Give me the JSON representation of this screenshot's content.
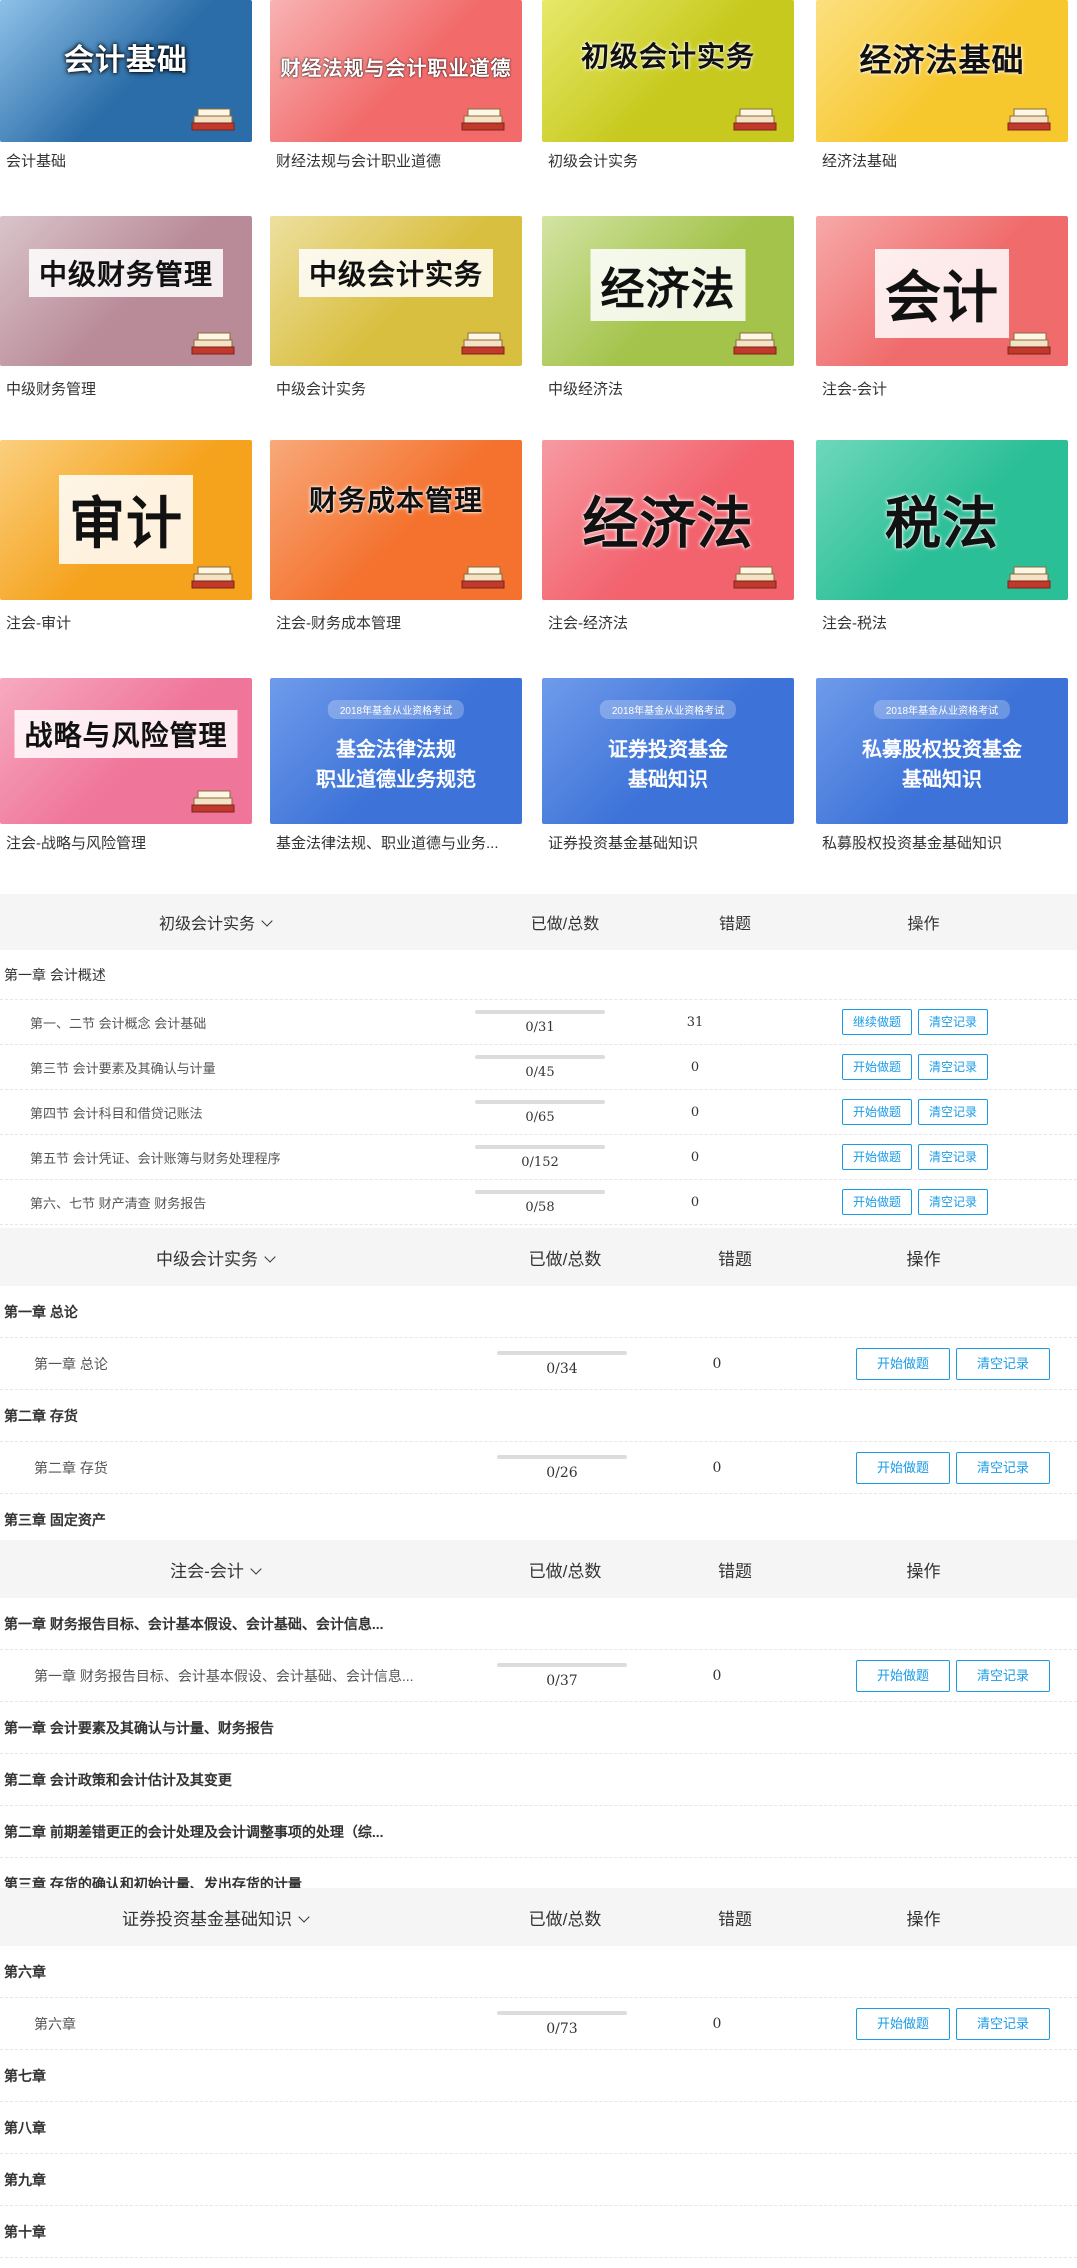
{
  "colors": {
    "accent": "#1a9be6",
    "header_bg": "#f5f5f5"
  },
  "courses": [
    {
      "title": "会计基础",
      "label": "会计基础",
      "bg": "#2b6da8",
      "bg2": "#8ec1e8",
      "style": "white-dark"
    },
    {
      "title": "财经法规与会计职业道德",
      "label": "财经法规与会计职业道德",
      "bg": "#f26a6a",
      "bg2": "#f8b3b3",
      "style": "white"
    },
    {
      "title": "初级会计实务",
      "label": "初级会计实务",
      "bg": "#c7c91e",
      "bg2": "#e7e96a",
      "style": "dark"
    },
    {
      "title": "经济法基础",
      "label": "经济法基础",
      "bg": "#f7c72e",
      "bg2": "#fbe07f",
      "style": "dark"
    },
    {
      "title": "中级财务管理",
      "label": "中级财务管理",
      "bg": "#b98a98",
      "bg2": "#d9c4ca",
      "style": "boxed"
    },
    {
      "title": "中级会计实务",
      "label": "中级会计实务",
      "bg": "#d9bf40",
      "bg2": "#ede0a0",
      "style": "boxed"
    },
    {
      "title": "经济法",
      "label": "中级经济法",
      "bg": "#a3c34b",
      "bg2": "#d3e4a3",
      "style": "boxed"
    },
    {
      "title": "会计",
      "label": "注会-会计",
      "bg": "#f06b6b",
      "bg2": "#f7a9a9",
      "style": "boxed-big"
    },
    {
      "title": "审计",
      "label": "注会-审计",
      "bg": "#f5a21c",
      "bg2": "#fbcf7e",
      "style": "boxed-big"
    },
    {
      "title": "财务成本管理",
      "label": "注会-财务成本管理",
      "bg": "#f4722e",
      "bg2": "#f8a97a",
      "style": "dark"
    },
    {
      "title": "经济法",
      "label": "注会-经济法",
      "bg": "#f2636e",
      "bg2": "#f79aa2",
      "style": "dark-big"
    },
    {
      "title": "税法",
      "label": "注会-税法",
      "bg": "#2bbf97",
      "bg2": "#6ed8bb",
      "style": "dark-big"
    },
    {
      "title": "战略与风险管理",
      "label": "注会-战略与风险管理",
      "bg": "#f0759a",
      "bg2": "#f6aac1",
      "style": "boxed"
    },
    {
      "title": "基金法律法规\n职业道德业务规范",
      "label": "基金法律法规、职业道德与业务...",
      "bg": "#3d73d8",
      "bg2": "#6f9bea",
      "style": "fund",
      "tag": "2018年基金从业资格考试"
    },
    {
      "title": "证券投资基金\n基础知识",
      "label": "证券投资基金基础知识",
      "bg": "#3d73d8",
      "bg2": "#6f9bea",
      "style": "fund",
      "tag": "2018年基金从业资格考试"
    },
    {
      "title": "私募股权投资基金\n基础知识",
      "label": "私募股权投资基金基础知识",
      "bg": "#3d73d8",
      "bg2": "#6f9bea",
      "style": "fund",
      "tag": "2018年基金从业资格考试"
    }
  ],
  "sections": [
    {
      "name": "初级会计实务",
      "col_done": "已做/总数",
      "col_wrong": "错题",
      "col_ops": "操作",
      "size": "small",
      "rows": [
        {
          "type": "chapter",
          "text": "第一章 会计概述"
        },
        {
          "type": "lesson",
          "text": "第一、二节 会计概念 会计基础",
          "done": 0,
          "total": 31,
          "count": "0/31",
          "wrong": "31",
          "btn1": "继续做题",
          "btn2": "清空记录"
        },
        {
          "type": "lesson",
          "text": "第三节 会计要素及其确认与计量",
          "done": 0,
          "total": 45,
          "count": "0/45",
          "wrong": "0",
          "btn1": "开始做题",
          "btn2": "清空记录"
        },
        {
          "type": "lesson",
          "text": "第四节 会计科目和借贷记账法",
          "done": 0,
          "total": 65,
          "count": "0/65",
          "wrong": "0",
          "btn1": "开始做题",
          "btn2": "清空记录"
        },
        {
          "type": "lesson",
          "text": "第五节 会计凭证、会计账簿与财务处理程序",
          "done": 0,
          "total": 152,
          "count": "0/152",
          "wrong": "0",
          "btn1": "开始做题",
          "btn2": "清空记录"
        },
        {
          "type": "lesson",
          "text": "第六、七节 财产清查 财务报告",
          "done": 0,
          "total": 58,
          "count": "0/58",
          "wrong": "0",
          "btn1": "开始做题",
          "btn2": "清空记录"
        }
      ]
    },
    {
      "name": "中级会计实务",
      "col_done": "已做/总数",
      "col_wrong": "错题",
      "col_ops": "操作",
      "size": "big",
      "rows": [
        {
          "type": "chapter",
          "text": "第一章 总论"
        },
        {
          "type": "lesson",
          "text": "第一章 总论",
          "done": 0,
          "total": 34,
          "count": "0/34",
          "wrong": "0",
          "btn1": "开始做题",
          "btn2": "清空记录"
        },
        {
          "type": "chapter",
          "text": "第二章 存货"
        },
        {
          "type": "lesson",
          "text": "第二章 存货",
          "done": 0,
          "total": 26,
          "count": "0/26",
          "wrong": "0",
          "btn1": "开始做题",
          "btn2": "清空记录"
        },
        {
          "type": "chapter",
          "text": "第三章 固定资产"
        }
      ]
    },
    {
      "name": "注会-会计",
      "col_done": "已做/总数",
      "col_wrong": "错题",
      "col_ops": "操作",
      "size": "big",
      "rows": [
        {
          "type": "chapter",
          "text": "第一章 财务报告目标、会计基本假设、会计基础、会计信息..."
        },
        {
          "type": "lesson",
          "text": "第一章 财务报告目标、会计基本假设、会计基础、会计信息...",
          "done": 0,
          "total": 37,
          "count": "0/37",
          "wrong": "0",
          "btn1": "开始做题",
          "btn2": "清空记录"
        },
        {
          "type": "chapter",
          "text": "第一章 会计要素及其确认与计量、财务报告"
        },
        {
          "type": "chapter",
          "text": "第二章 会计政策和会计估计及其变更"
        },
        {
          "type": "chapter",
          "text": "第二章 前期差错更正的会计处理及会计调整事项的处理（综..."
        },
        {
          "type": "chapter",
          "text": "第三章 存货的确认和初始计量、发出存货的计量"
        }
      ]
    },
    {
      "name": "证券投资基金基础知识",
      "col_done": "已做/总数",
      "col_wrong": "错题",
      "col_ops": "操作",
      "size": "big",
      "rows": [
        {
          "type": "chapter",
          "text": "第六章"
        },
        {
          "type": "lesson",
          "text": "第六章",
          "done": 0,
          "total": 73,
          "count": "0/73",
          "wrong": "0",
          "btn1": "开始做题",
          "btn2": "清空记录"
        },
        {
          "type": "chapter",
          "text": "第七章"
        },
        {
          "type": "chapter",
          "text": "第八章"
        },
        {
          "type": "chapter",
          "text": "第九章"
        },
        {
          "type": "chapter",
          "text": "第十章"
        }
      ]
    }
  ]
}
